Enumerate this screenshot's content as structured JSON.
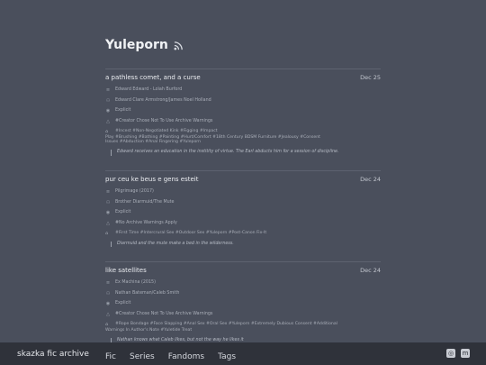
{
  "page": {
    "title": "Yuleporn"
  },
  "entries": [
    {
      "title": "a pathless comet, and a curse",
      "date": "Dec 25",
      "fandom": "Edward Edward - Loïah Burford",
      "relationship": "Edward Clare Armstrong/James Noel Holland",
      "rating": "Explicit",
      "warnings": "#Creator Chose Not To Use Archive Warnings",
      "tags_line1": "#Incest #Non-Negotiated Kink #Figging #Impact",
      "tags_line2": "Play #Brushing #Bathing #Painting #Hurt/Comfort #18th Century BDSM Furniture #Jealousy #Consent",
      "tags_line3": "Issues #Abduction #Anal Fingering #Yuleporn",
      "summary": "Edward receives an education in the institity of virtue. The Earl abducts him for a session of discipline."
    },
    {
      "title": "pur ceu ke beus e gens esteit",
      "date": "Dec 24",
      "fandom": "Pilgrimage (2017)",
      "relationship": "Brother Diarmuid/The Mute",
      "rating": "Explicit",
      "warnings": "#No Archive Warnings Apply",
      "tags_line1": "#First Time #Intercrural Sex #Outdoor Sex #Yuleporn #Post-Canon Fix-It",
      "tags_line2": "",
      "tags_line3": "",
      "summary": "Diarmuid and the mute make a bed in the wilderness."
    },
    {
      "title": "like satellites",
      "date": "Dec 24",
      "fandom": "Ex Machina (2015)",
      "relationship": "Nathan Bateman/Caleb Smith",
      "rating": "Explicit",
      "warnings": "#Creator Chose Not To Use Archive Warnings",
      "tags_line1": "#Rope Bondage #Face Slapping #Anal Sex #Oral Sex #Yuleporn #Extremely Dubious Consent #Additional",
      "tags_line2": "Warnings In Author's Note #Yuletide Treat",
      "tags_line3": "",
      "summary": "Nathan knows what Caleb likes, but not the way he likes it"
    }
  ],
  "footer": {
    "site_name": "skazka fic archive",
    "nav": [
      "Fic",
      "Series",
      "Fandoms",
      "Tags"
    ]
  },
  "colors": {
    "background": "#4a4f5c",
    "footer": "#2f323a",
    "text": "#cfd3db"
  },
  "icons": [
    "rss-icon",
    "book-icon",
    "people-icon",
    "eye-icon",
    "warning-icon",
    "tag-icon",
    "instagram-icon",
    "mastodon-icon"
  ]
}
